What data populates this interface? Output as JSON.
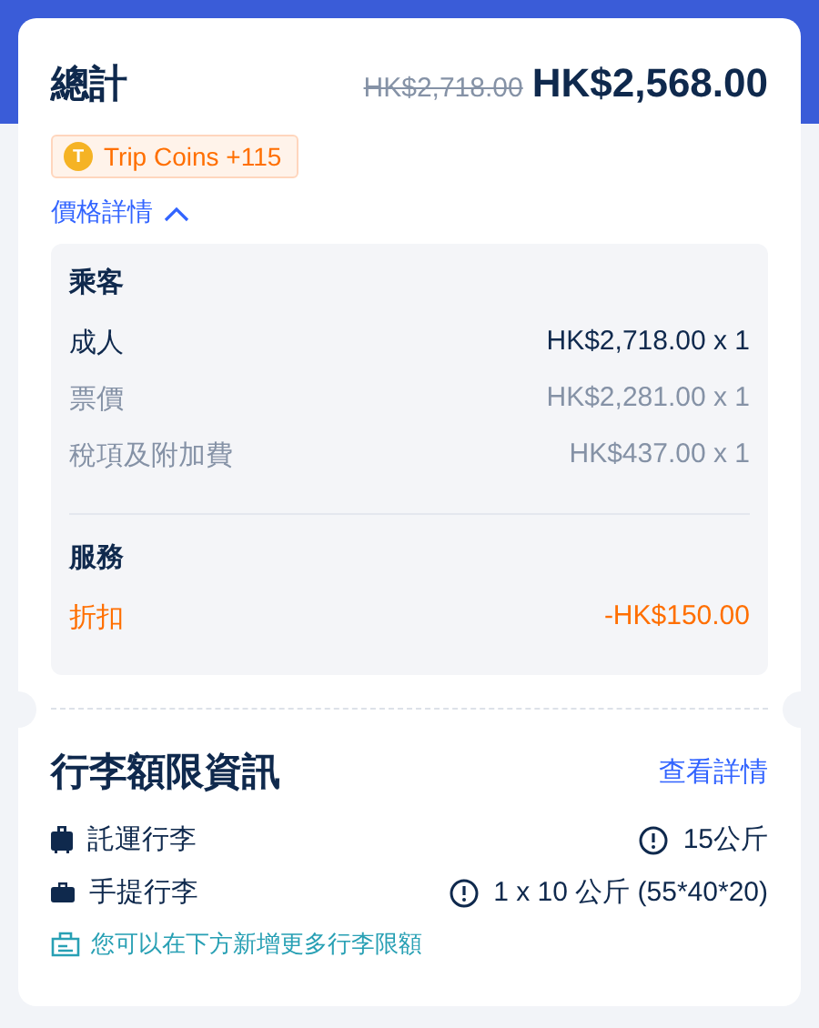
{
  "total": {
    "label": "總計",
    "original_price": "HK$2,718.00",
    "price": "HK$2,568.00"
  },
  "coins": {
    "label": "Trip Coins +115",
    "icon_letter": "T"
  },
  "details_toggle": {
    "label": "價格詳情",
    "expanded": true
  },
  "sections": [
    {
      "title": "乘客",
      "rows": [
        {
          "label": "成人",
          "value": "HK$2,718.00 x 1",
          "kind": "main"
        },
        {
          "label": "票價",
          "value": "HK$2,281.00 x 1",
          "kind": "sub"
        },
        {
          "label": "稅項及附加費",
          "value": "HK$437.00 x 1",
          "kind": "sub"
        }
      ]
    },
    {
      "title": "服務",
      "rows": [
        {
          "label": "折扣",
          "value": "-HK$150.00",
          "kind": "discount"
        }
      ]
    }
  ],
  "baggage": {
    "title": "行李額限資訊",
    "link": "查看詳情",
    "items": [
      {
        "kind": "checked",
        "label": "託運行李",
        "value": "15公斤"
      },
      {
        "kind": "cabin",
        "label": "手提行李",
        "value": "1 x 10 公斤 (55*40*20)"
      }
    ],
    "note": "您可以在下方新增更多行李限額"
  }
}
